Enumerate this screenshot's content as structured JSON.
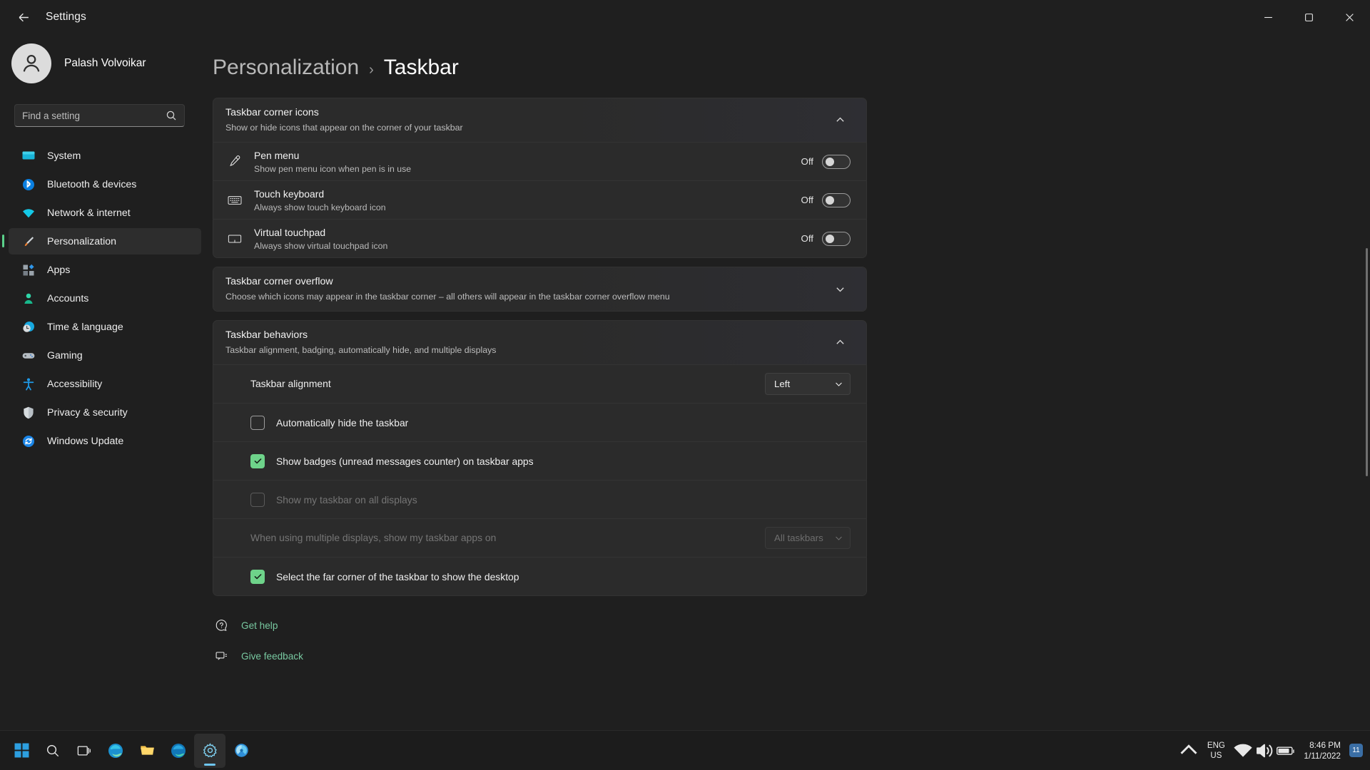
{
  "window": {
    "title": "Settings",
    "back_icon": "back-arrow-icon",
    "minimize_label": "Minimize",
    "maximize_label": "Restore",
    "close_label": "Close"
  },
  "sidebar": {
    "profile_name": "Palash Volvoikar",
    "search": {
      "placeholder": "Find a setting",
      "value": "",
      "icon": "search-icon"
    },
    "items": [
      {
        "label": "System",
        "icon": "monitor-icon",
        "active": false
      },
      {
        "label": "Bluetooth & devices",
        "icon": "bluetooth-icon",
        "active": false
      },
      {
        "label": "Network & internet",
        "icon": "wifi-icon",
        "active": false
      },
      {
        "label": "Personalization",
        "icon": "paintbrush-icon",
        "active": true
      },
      {
        "label": "Apps",
        "icon": "apps-icon",
        "active": false
      },
      {
        "label": "Accounts",
        "icon": "person-icon",
        "active": false
      },
      {
        "label": "Time & language",
        "icon": "clock-globe-icon",
        "active": false
      },
      {
        "label": "Gaming",
        "icon": "gamepad-icon",
        "active": false
      },
      {
        "label": "Accessibility",
        "icon": "accessibility-icon",
        "active": false
      },
      {
        "label": "Privacy & security",
        "icon": "shield-icon",
        "active": false
      },
      {
        "label": "Windows Update",
        "icon": "update-icon",
        "active": false
      }
    ]
  },
  "breadcrumb": {
    "parent": "Personalization",
    "separator": "›",
    "current": "Taskbar"
  },
  "sections": [
    {
      "title": "Taskbar corner icons",
      "subtitle": "Show or hide icons that appear on the corner of your taskbar",
      "expanded": true,
      "chevron": "chevron-up-icon",
      "rows": [
        {
          "type": "toggle",
          "icon": "pen-icon",
          "title": "Pen menu",
          "subtitle": "Show pen menu icon when pen is in use",
          "state": "Off",
          "on": false
        },
        {
          "type": "toggle",
          "icon": "keyboard-icon",
          "title": "Touch keyboard",
          "subtitle": "Always show touch keyboard icon",
          "state": "Off",
          "on": false
        },
        {
          "type": "toggle",
          "icon": "touchpad-icon",
          "title": "Virtual touchpad",
          "subtitle": "Always show virtual touchpad icon",
          "state": "Off",
          "on": false
        }
      ]
    },
    {
      "title": "Taskbar corner overflow",
      "subtitle": "Choose which icons may appear in the taskbar corner – all others will appear in the taskbar corner overflow menu",
      "expanded": false,
      "chevron": "chevron-down-icon",
      "rows": []
    },
    {
      "title": "Taskbar behaviors",
      "subtitle": "Taskbar alignment, badging, automatically hide, and multiple displays",
      "expanded": true,
      "chevron": "chevron-up-icon",
      "rows": [
        {
          "type": "select",
          "label": "Taskbar alignment",
          "value": "Left",
          "disabled": false,
          "chevron": "chevron-down-icon"
        },
        {
          "type": "checkbox",
          "label": "Automatically hide the taskbar",
          "checked": false,
          "disabled": false
        },
        {
          "type": "checkbox",
          "label": "Show badges (unread messages counter) on taskbar apps",
          "checked": true,
          "disabled": false
        },
        {
          "type": "checkbox",
          "label": "Show my taskbar on all displays",
          "checked": false,
          "disabled": true
        },
        {
          "type": "select",
          "label": "When using multiple displays, show my taskbar apps on",
          "value": "All taskbars",
          "disabled": true,
          "chevron": "chevron-down-icon"
        },
        {
          "type": "checkbox",
          "label": "Select the far corner of the taskbar to show the desktop",
          "checked": true,
          "disabled": false
        }
      ]
    }
  ],
  "footer": [
    {
      "label": "Get help",
      "icon": "help-icon"
    },
    {
      "label": "Give feedback",
      "icon": "feedback-icon"
    }
  ],
  "taskbar": {
    "apps": [
      {
        "name": "start-button",
        "icon": "windows-logo-icon",
        "active": false
      },
      {
        "name": "search-button",
        "icon": "search-icon",
        "active": false
      },
      {
        "name": "task-view-button",
        "icon": "task-view-icon",
        "active": false
      },
      {
        "name": "edge-button",
        "icon": "edge-icon",
        "active": false
      },
      {
        "name": "file-explorer-button",
        "icon": "folder-icon",
        "active": false
      },
      {
        "name": "edge-dev-button",
        "icon": "edge-dev-icon",
        "active": false
      },
      {
        "name": "settings-button",
        "icon": "gear-icon",
        "active": true
      },
      {
        "name": "store-button",
        "icon": "store-icon",
        "active": false
      }
    ],
    "tray": {
      "overflow_icon": "chevron-up-icon",
      "language": {
        "line1": "ENG",
        "line2": "US"
      },
      "network_icon": "wifi-icon",
      "volume_icon": "speaker-icon",
      "battery_icon": "battery-icon",
      "time": "8:46 PM",
      "date": "1/11/2022",
      "notification_count": "11"
    }
  },
  "colors": {
    "accent_green": "#6ed38a",
    "link_green": "#78c8a0",
    "card_bg": "#2b2b2b",
    "page_bg": "#1f1f1f"
  }
}
